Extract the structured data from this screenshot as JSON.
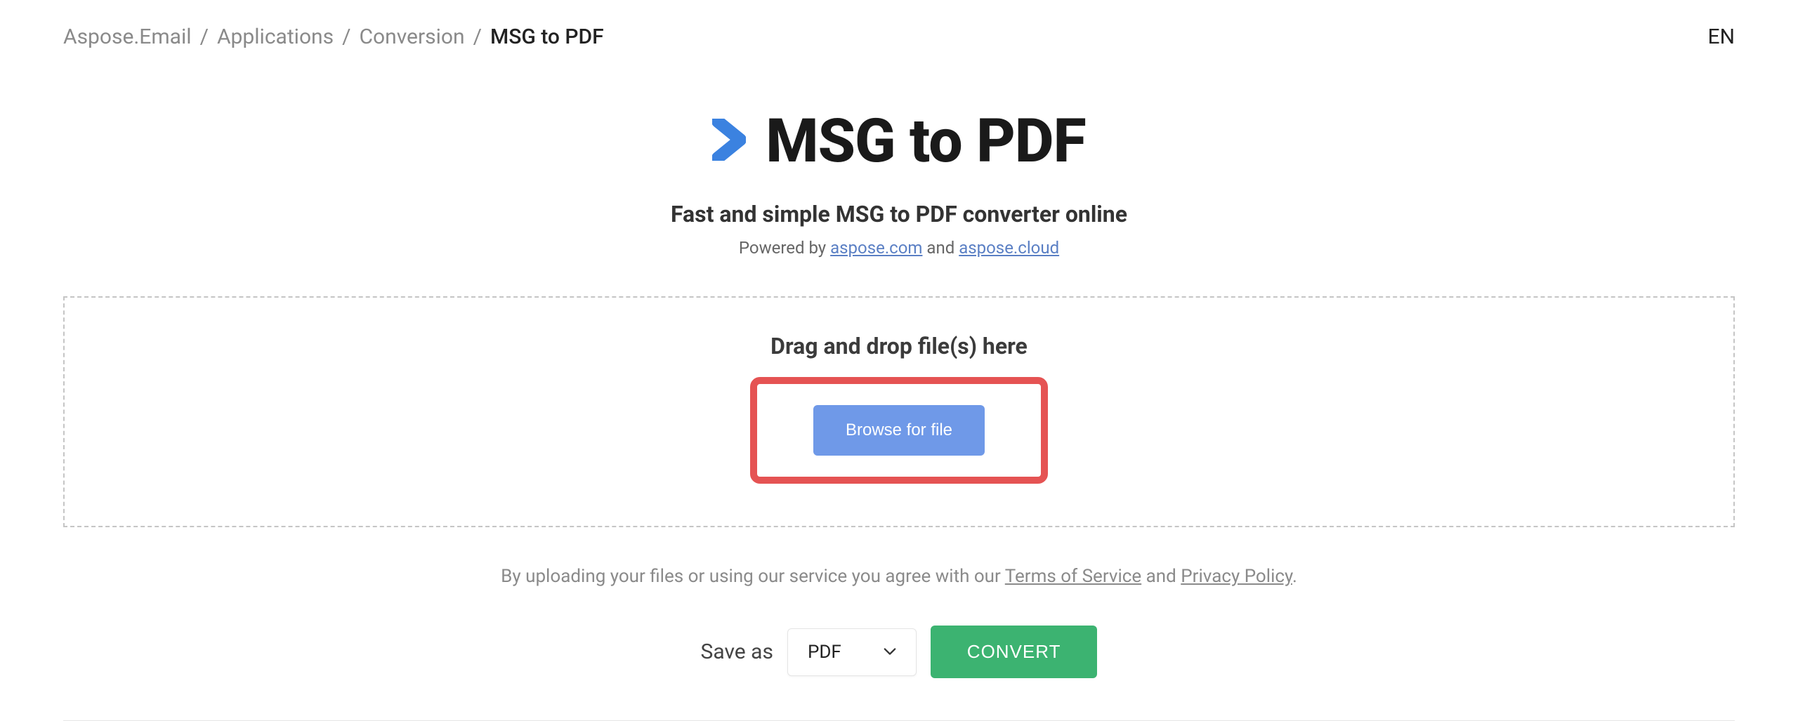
{
  "breadcrumb": {
    "items": [
      "Aspose.Email",
      "Applications",
      "Conversion"
    ],
    "current": "MSG to PDF"
  },
  "lang": "EN",
  "hero": {
    "title": "MSG to PDF",
    "subtitle": "Fast and simple MSG to PDF converter online",
    "powered_prefix": "Powered by ",
    "powered_link1": "aspose.com",
    "powered_mid": " and ",
    "powered_link2": "aspose.cloud"
  },
  "dropzone": {
    "text": "Drag and drop file(s) here",
    "browse": "Browse for file"
  },
  "agree": {
    "prefix": "By uploading your files or using our service you agree with our ",
    "tos": "Terms of Service",
    "mid": " and ",
    "privacy": "Privacy Policy",
    "suffix": "."
  },
  "controls": {
    "save_label": "Save as",
    "format": "PDF",
    "convert": "CONVERT"
  }
}
